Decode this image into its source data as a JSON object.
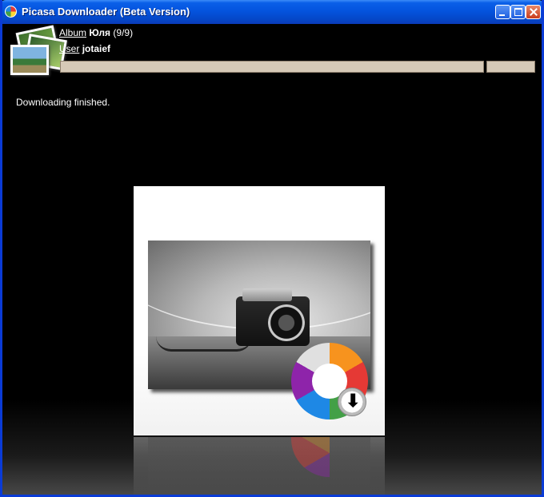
{
  "window": {
    "title": "Picasa Downloader (Beta Version)"
  },
  "info": {
    "album_label": "Album",
    "album_name": "Юля",
    "album_count": "(9/9)",
    "user_label": "User",
    "user_name": "jotaief"
  },
  "status": {
    "message": "Downloading finished."
  },
  "icons": {
    "app": "picasa-app-icon",
    "photos": "photos-stack-icon",
    "download": "download-arrow-icon"
  }
}
